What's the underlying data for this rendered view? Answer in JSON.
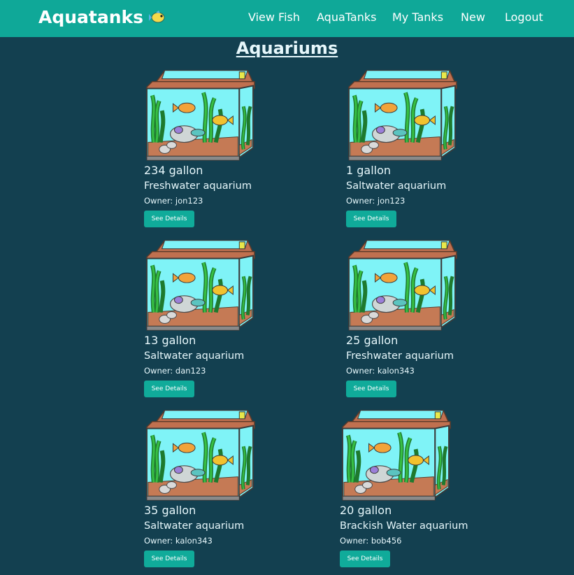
{
  "nav": {
    "brand": "Aquatanks",
    "brand_icon": "fish-icon",
    "links": [
      "View Fish",
      "AquaTanks",
      "My Tanks",
      "New",
      "Logout"
    ]
  },
  "page": {
    "title": "Aquariums"
  },
  "aquariums": [
    {
      "gallons": "234 gallon",
      "type": "Freshwater aquarium",
      "owner_label": "Owner:",
      "owner": "jon123",
      "button": "See Details",
      "image": "aquarium-image"
    },
    {
      "gallons": "1 gallon",
      "type": "Saltwater aquarium",
      "owner_label": "Owner:",
      "owner": "jon123",
      "button": "See Details",
      "image": "aquarium-image"
    },
    {
      "gallons": "13 gallon",
      "type": "Saltwater aquarium",
      "owner_label": "Owner:",
      "owner": "dan123",
      "button": "See Details",
      "image": "aquarium-image"
    },
    {
      "gallons": "25 gallon",
      "type": "Freshwater aquarium",
      "owner_label": "Owner:",
      "owner": "kalon343",
      "button": "See Details",
      "image": "aquarium-image"
    },
    {
      "gallons": "35 gallon",
      "type": "Saltwater aquarium",
      "owner_label": "Owner:",
      "owner": "kalon343",
      "button": "See Details",
      "image": "aquarium-image"
    },
    {
      "gallons": "20 gallon",
      "type": "Brackish Water aquarium",
      "owner_label": "Owner:",
      "owner": "bob456",
      "button": "See Details",
      "image": "aquarium-image"
    }
  ],
  "colors": {
    "navbar": "#0fa898",
    "background": "#134050",
    "button": "#10ab9a",
    "text": "#e6f7fb"
  }
}
